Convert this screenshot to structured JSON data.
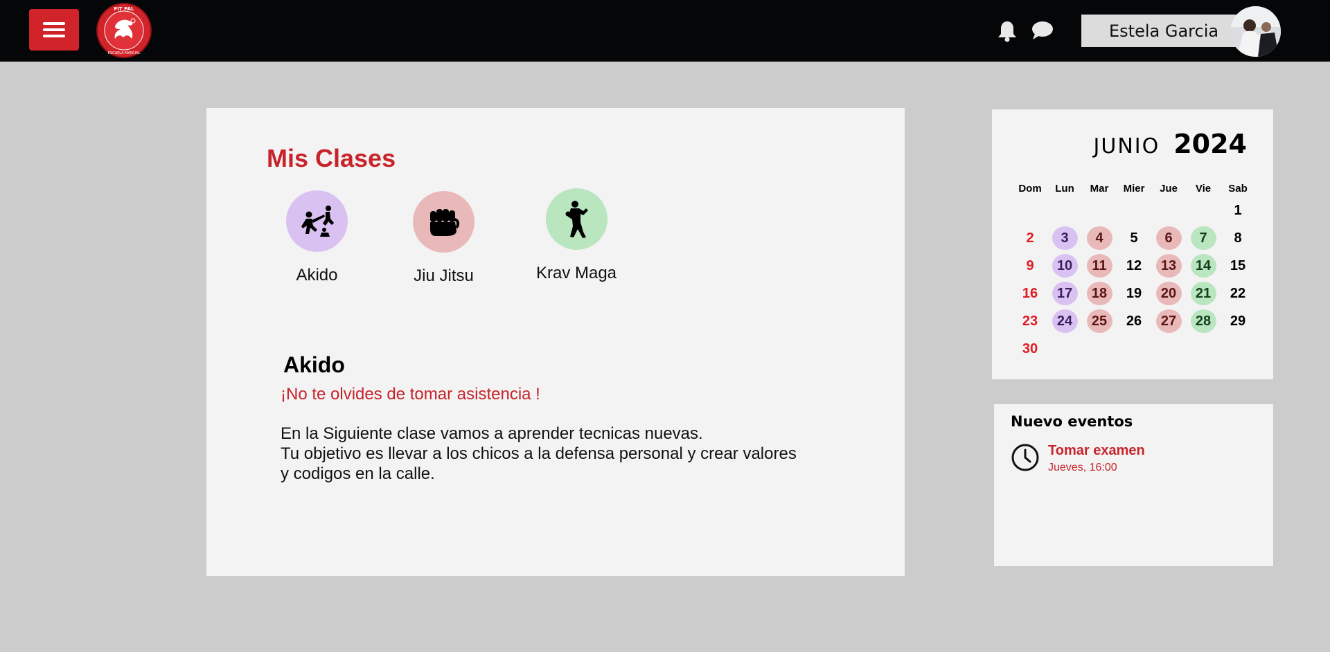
{
  "header": {
    "user_name": "Estela Garcia",
    "logo_text_top": "FIT PAL",
    "logo_text_bottom": "ESCUELA MARCIAL"
  },
  "classes": {
    "title": "Mis Clases",
    "items": [
      {
        "label": "Akido",
        "color": "#d9c2f2",
        "icon": "akido-icon"
      },
      {
        "label": "Jiu Jitsu",
        "color": "#e9b9b9",
        "icon": "fist-icon"
      },
      {
        "label": "Krav Maga",
        "color": "#b9e5bf",
        "icon": "fighter-icon"
      }
    ]
  },
  "detail": {
    "title": "Akido",
    "reminder": "¡No te olvides de tomar asistencia !",
    "description": [
      "En la Siguiente clase vamos a aprender tecnicas nuevas.",
      "Tu objetivo es llevar a los chicos a la defensa personal y crear valores",
      "y codigos en la calle."
    ]
  },
  "calendar": {
    "month": "JUNIO",
    "year": "2024",
    "weekdays": [
      "Dom",
      "Lun",
      "Mar",
      "Mier",
      "Jue",
      "Vie",
      "Sab"
    ],
    "weeks": [
      [
        null,
        null,
        null,
        null,
        null,
        null,
        1
      ],
      [
        2,
        3,
        4,
        5,
        6,
        7,
        8
      ],
      [
        9,
        10,
        11,
        12,
        13,
        14,
        15
      ],
      [
        16,
        17,
        18,
        19,
        20,
        21,
        22
      ],
      [
        23,
        24,
        25,
        26,
        27,
        28,
        29
      ],
      [
        30,
        null,
        null,
        null,
        null,
        null,
        null
      ]
    ],
    "class_colors": {
      "akido": "#d9c2f2",
      "jiu": "#e9b9b9",
      "krav": "#b9e5bf",
      "sunday": "#e01b22"
    },
    "highlights": {
      "akido": [
        3,
        10,
        17,
        24
      ],
      "jiu": [
        4,
        6,
        11,
        13,
        18,
        20,
        25,
        27
      ],
      "krav": [
        7,
        14,
        21,
        28
      ]
    }
  },
  "events": {
    "title": "Nuevo eventos",
    "items": [
      {
        "name": "Tomar examen",
        "time": "Jueves, 16:00",
        "icon": "clock-icon"
      }
    ]
  },
  "colors": {
    "accent": "#c8232b",
    "topbar": "#050608",
    "background": "#cccccc",
    "card": "#f3f3f3"
  }
}
